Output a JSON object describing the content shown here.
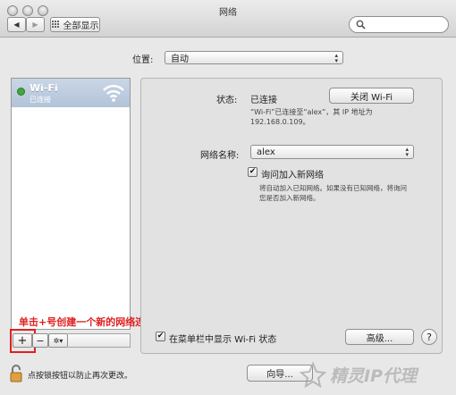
{
  "window": {
    "title": "网络"
  },
  "toolbar": {
    "back_label": "◀",
    "forward_label": "▶",
    "show_all_label": "全部显示",
    "search_placeholder": ""
  },
  "location": {
    "label": "位置:",
    "value": "自动"
  },
  "services": [
    {
      "name": "Wi-Fi",
      "status": "已连接",
      "status_color": "#3fa83a"
    }
  ],
  "detail": {
    "status_label": "状态:",
    "status_value": "已连接",
    "turn_off_button": "关闭 Wi-Fi",
    "status_desc_line1": "“Wi-Fi”已连接至“alex”，其 IP 地址为",
    "status_desc_line2": "192.168.0.109。",
    "network_name_label": "网络名称:",
    "network_name_value": "alex",
    "ask_join_label": "询问加入新网络",
    "ask_join_checked": true,
    "ask_join_desc_line1": "将自动加入已知网络。如果没有已知网络，将询问",
    "ask_join_desc_line2": "您是否加入新网络。",
    "show_menu_label": "在菜单栏中显示 Wi-Fi 状态",
    "show_menu_checked": true,
    "advanced_button": "高级...",
    "help_button": "?"
  },
  "list_controls": {
    "add": "+",
    "remove": "−",
    "gear": "✲▾"
  },
  "annotation": {
    "text": "单击+号创建一个新的网络连接",
    "color": "#e02020"
  },
  "footer": {
    "lock_text": "点按锁按钮以防止再次更改。",
    "assistant_button": "向导..."
  },
  "watermark": {
    "text": "精灵IP代理"
  }
}
